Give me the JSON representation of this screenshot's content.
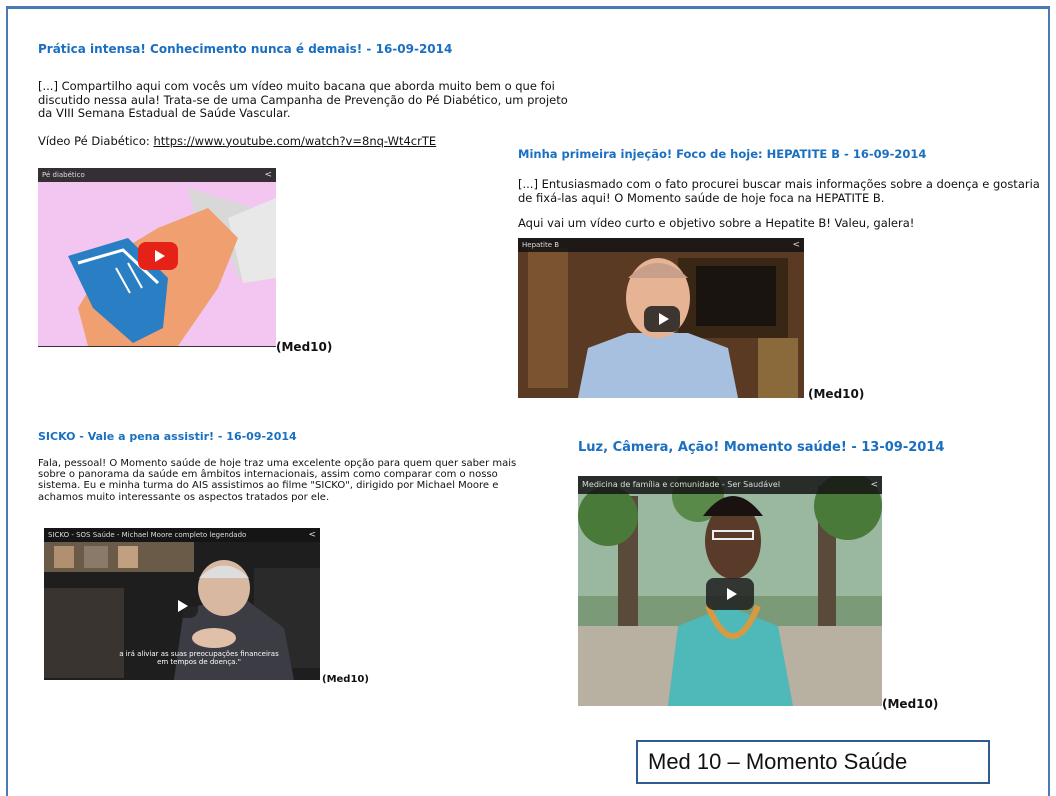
{
  "posts": [
    {
      "title": "Prática intensa! Conhecimento nunca é demais! - 16-09-2014",
      "body": "[...] Compartilho aqui com vocês um vídeo muito bacana que aborda muito bem o que foi discutido nessa aula! Trata-se de uma Campanha de Prevenção do Pé Diabético, um projeto da VIII Semana Estadual de Saúde Vascular.",
      "link_prefix": "Vídeo Pé Diabético: ",
      "link": "https://www.youtube.com/watch?v=8nq-Wt4crTE",
      "video_title": "Pé diabético",
      "author": "(Med10)"
    },
    {
      "title": "Minha primeira injeção! Foco de hoje: HEPATITE B - 16-09-2014",
      "body": "[...] Entusiasmado com o fato procurei buscar mais informações sobre a doença e gostaria de fixá-las aqui! O Momento saúde de hoje foca na HEPATITE B.",
      "body2": "Aqui vai um vídeo curto e objetivo sobre a Hepatite B! Valeu, galera!",
      "video_title": "Hepatite B",
      "author": "(Med10)"
    },
    {
      "title": "SICKO - Vale a pena assistir! - 16-09-2014",
      "body": "Fala, pessoal! O Momento saúde de hoje traz uma excelente opção para quem quer saber mais sobre o panorama da saúde em âmbitos internacionais, assim como comparar com o nosso sistema. Eu e minha turma do AIS assistimos ao filme \"SICKO\", dirigido por Michael Moore e achamos muito interessante os aspectos tratados por ele.",
      "video_title": "SICKO - SOS Saúde - Michael Moore completo legendado",
      "caption": "a irá aliviar as suas preocupações financeiras em tempos de doença.\"",
      "author": "(Med10)"
    },
    {
      "title": "Luz, Câmera, Ação! Momento saúde! - 13-09-2014",
      "video_title": "Medicina de família e comunidade - Ser Saudável",
      "author": "(Med10)"
    }
  ],
  "footer_box": "Med 10 – Momento Saúde",
  "colors": {
    "title": "#1a6fc0",
    "play_red": "#e62117",
    "frame": "#4a7ab5"
  }
}
